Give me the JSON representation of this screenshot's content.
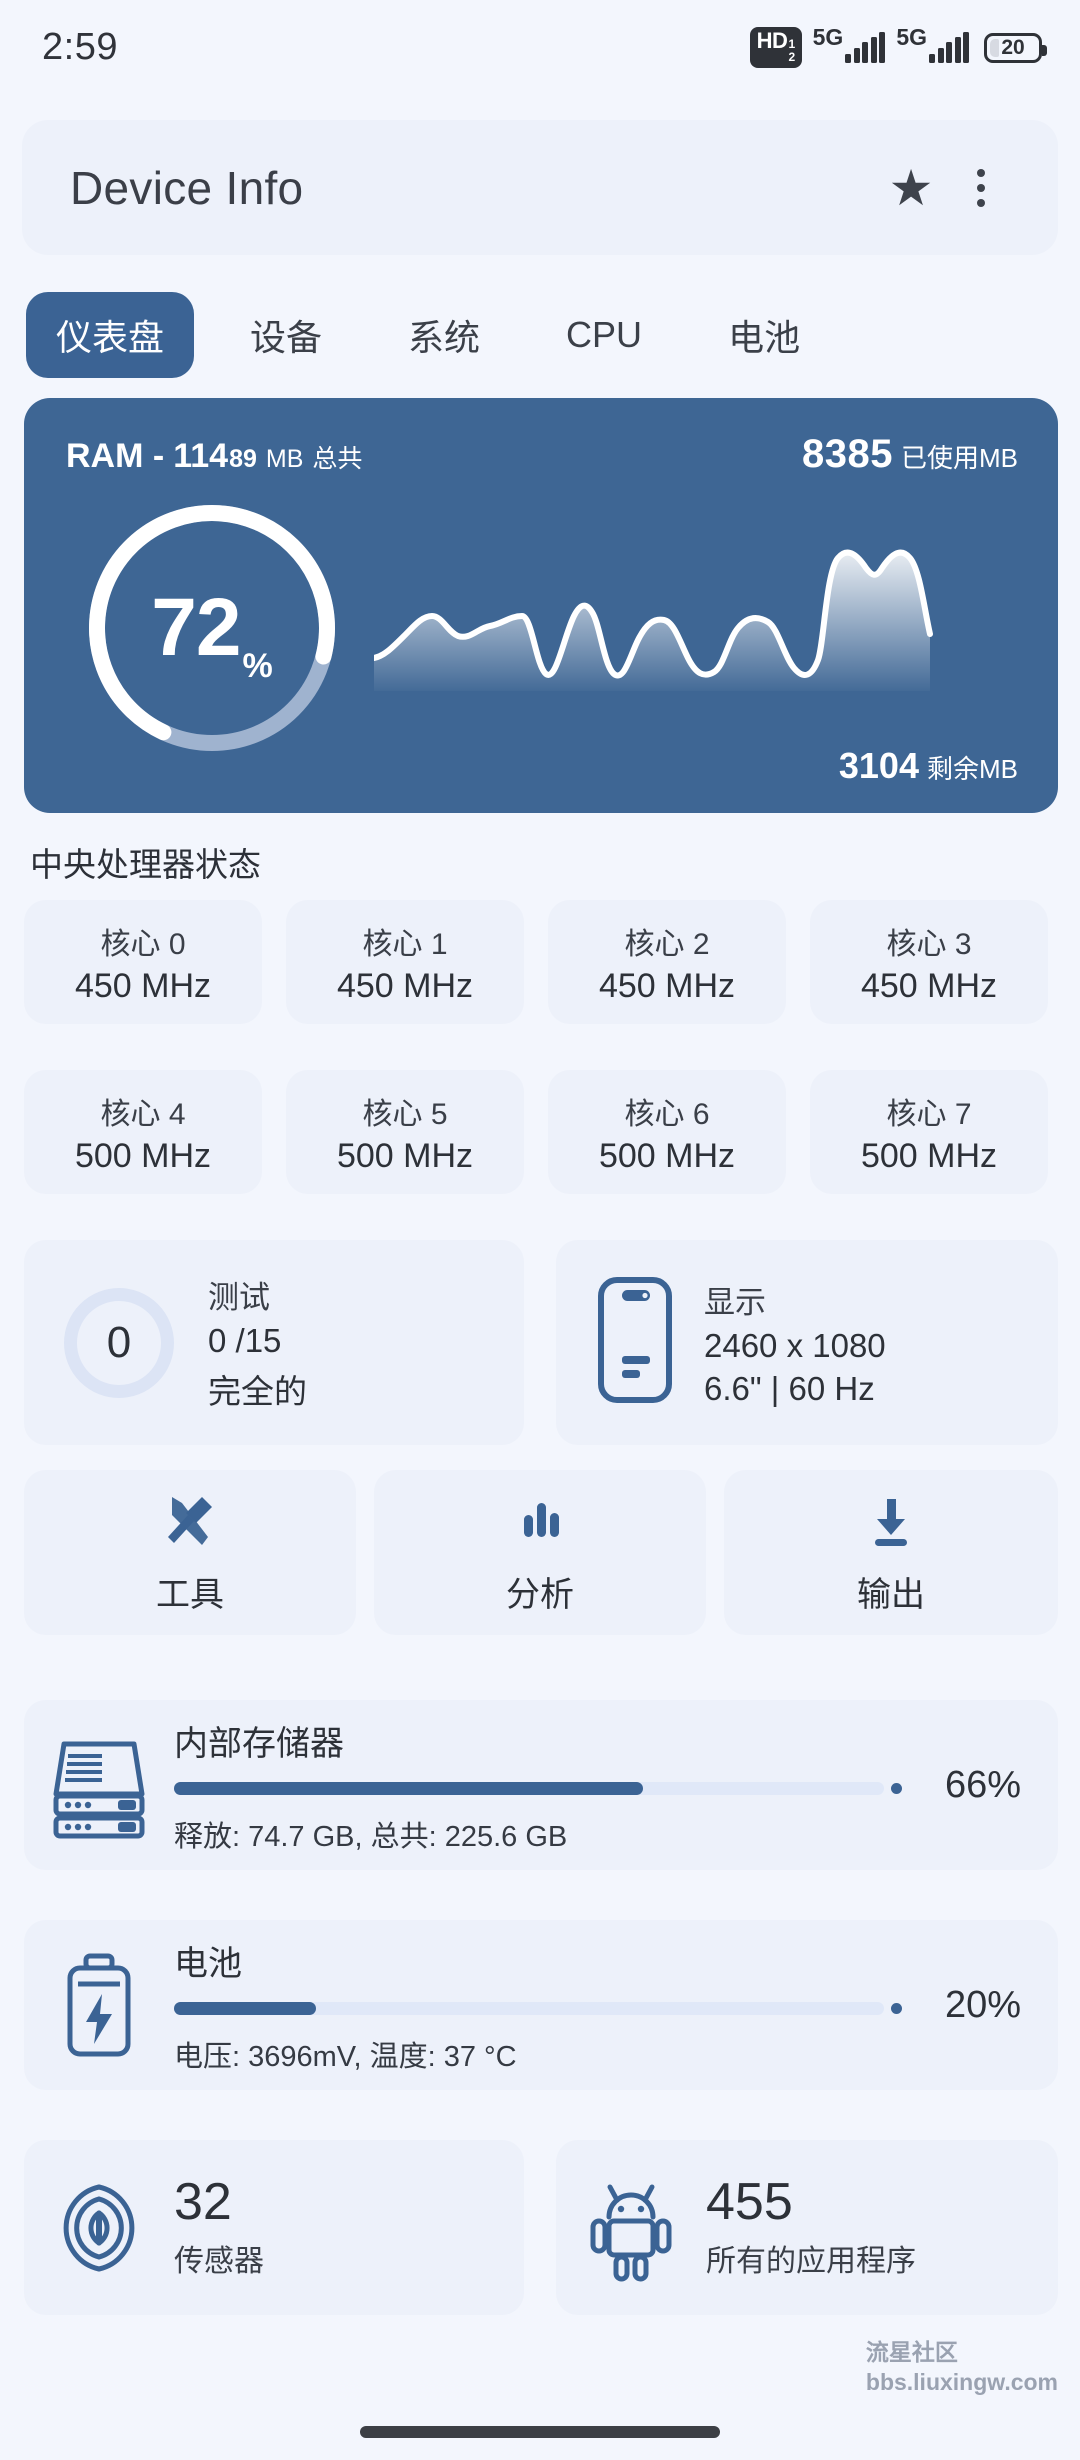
{
  "status_bar": {
    "time": "2:59",
    "hd_label": "HD",
    "hd_sub_top": "1",
    "hd_sub_bottom": "2",
    "net1": "5G",
    "net2": "5G",
    "battery_percent": "20"
  },
  "header": {
    "title": "Device Info",
    "star_icon": "star-icon",
    "menu_icon": "overflow-menu-icon"
  },
  "tabs": [
    {
      "label": "仪表盘",
      "active": true
    },
    {
      "label": "设备",
      "active": false
    },
    {
      "label": "系统",
      "active": false
    },
    {
      "label": "CPU",
      "active": false
    },
    {
      "label": "电池",
      "active": false
    }
  ],
  "ram_card": {
    "prefix": "RAM -",
    "total_major": "114",
    "total_minor": "89",
    "total_unit": "MB",
    "total_label": "总共",
    "used_value": "8385",
    "used_label": "已使用MB",
    "percent_value": "72",
    "percent_symbol": "%",
    "free_value": "3104",
    "free_label": "剩余MB",
    "accent": "#3e6694"
  },
  "cpu_section": {
    "title": "中央处理器状态",
    "cores": [
      {
        "name": "核心 0",
        "freq": "450 MHz"
      },
      {
        "name": "核心 1",
        "freq": "450 MHz"
      },
      {
        "name": "核心 2",
        "freq": "450 MHz"
      },
      {
        "name": "核心 3",
        "freq": "450 MHz"
      },
      {
        "name": "核心 4",
        "freq": "500 MHz"
      },
      {
        "name": "核心 5",
        "freq": "500 MHz"
      },
      {
        "name": "核心 6",
        "freq": "500 MHz"
      },
      {
        "name": "核心 7",
        "freq": "500 MHz"
      }
    ]
  },
  "test_card": {
    "ring_value": "0",
    "title": "测试",
    "line2": "0  /15",
    "line3": "完全的"
  },
  "display_card": {
    "title": "显示",
    "resolution": "2460 x 1080",
    "spec": "6.6\" | 60 Hz",
    "icon": "phone-icon"
  },
  "actions": [
    {
      "label": "工具",
      "icon": "tools-icon"
    },
    {
      "label": "分析",
      "icon": "bar-chart-icon"
    },
    {
      "label": "输出",
      "icon": "download-icon"
    }
  ],
  "storage": {
    "title": "内部存储器",
    "percent": "66%",
    "fill": 66,
    "detail": "释放: 74.7 GB,  总共: 225.6 GB",
    "icon": "storage-icon"
  },
  "battery": {
    "title": "电池",
    "percent": "20%",
    "fill": 20,
    "detail": "电压: 3696mV,  温度: 37 °C",
    "icon": "battery-icon"
  },
  "stats": [
    {
      "number": "32",
      "label": "传感器",
      "icon": "sensor-icon"
    },
    {
      "number": "455",
      "label": "所有的应用程序",
      "icon": "android-icon"
    }
  ],
  "watermark": {
    "line1": "流星社区",
    "line2": "bbs.liuxingw.com"
  },
  "colors": {
    "page_bg": "#f3f6fd",
    "card_bg": "#edf1fa",
    "accent": "#3b6394",
    "track": "#e0e8f8"
  }
}
